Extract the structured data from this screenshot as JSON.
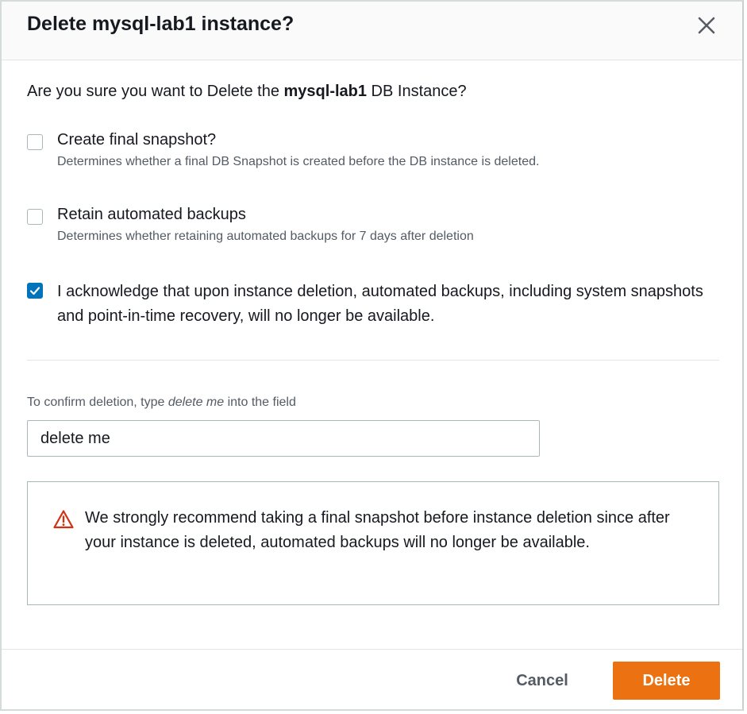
{
  "dialog": {
    "title": "Delete mysql-lab1 instance?",
    "close_icon": "close-icon"
  },
  "question": {
    "prefix": "Are you sure you want to Delete the ",
    "instance_name": "mysql-lab1",
    "suffix": " DB Instance?"
  },
  "options": {
    "final_snapshot": {
      "label": "Create final snapshot?",
      "description": "Determines whether a final DB Snapshot is created before the DB instance is deleted.",
      "checked": false
    },
    "retain_backups": {
      "label": "Retain automated backups",
      "description": "Determines whether retaining automated backups for 7 days after deletion",
      "checked": false
    },
    "acknowledge": {
      "label": "I acknowledge that upon instance deletion, automated backups, including system snapshots and point-in-time recovery, will no longer be available.",
      "checked": true
    }
  },
  "confirm": {
    "label_prefix": "To confirm deletion, type ",
    "label_keyword": "delete me",
    "label_suffix": " into the field",
    "input_value": "delete me"
  },
  "alert": {
    "icon": "warning-icon",
    "text": "We strongly recommend taking a final snapshot before instance deletion since after your instance is deleted, automated backups will no longer be available.",
    "icon_color": "#d13212"
  },
  "footer": {
    "cancel_label": "Cancel",
    "delete_label": "Delete"
  },
  "colors": {
    "primary_button": "#ec7211",
    "checkbox_checked": "#0073bb"
  }
}
